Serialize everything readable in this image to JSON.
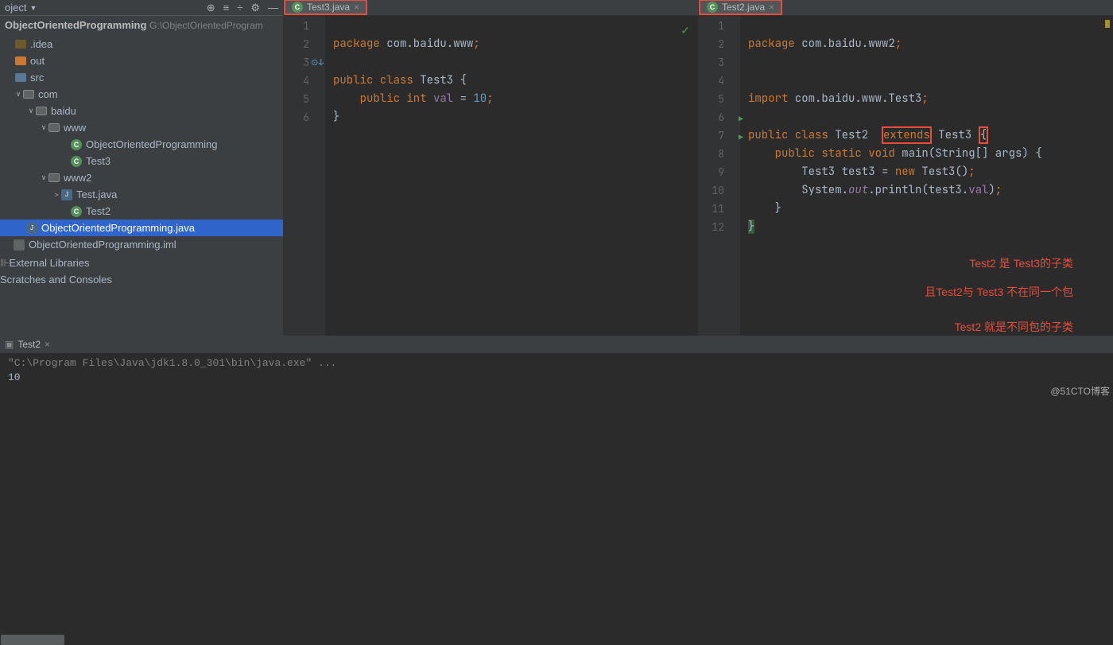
{
  "sidebar": {
    "dropdown": "oject",
    "proj_name": "ObjectOrientedProgramming",
    "proj_path": "G:\\ObjectOrientedProgram",
    "items": [
      {
        "indent": 8,
        "chev": "",
        "icon": "folder-idea",
        "label": ".idea"
      },
      {
        "indent": 8,
        "chev": "",
        "icon": "folder-out",
        "label": "out"
      },
      {
        "indent": 8,
        "chev": "",
        "icon": "folder-src",
        "label": "src"
      },
      {
        "indent": 18,
        "chev": "∨",
        "icon": "folder-pkg",
        "label": "com"
      },
      {
        "indent": 34,
        "chev": "∨",
        "icon": "folder-pkg",
        "label": "baidu"
      },
      {
        "indent": 50,
        "chev": "∨",
        "icon": "folder-pkg",
        "label": "www"
      },
      {
        "indent": 78,
        "chev": "",
        "icon": "class",
        "label": "ObjectOrientedProgramming"
      },
      {
        "indent": 78,
        "chev": "",
        "icon": "class",
        "label": "Test3"
      },
      {
        "indent": 50,
        "chev": "∨",
        "icon": "folder-pkg",
        "label": "www2"
      },
      {
        "indent": 66,
        "chev": ">",
        "icon": "java",
        "label": "Test.java"
      },
      {
        "indent": 78,
        "chev": "",
        "icon": "class",
        "label": "Test2"
      },
      {
        "indent": 22,
        "chev": "",
        "icon": "java",
        "label": "ObjectOrientedProgramming.java",
        "selected": true
      },
      {
        "indent": 6,
        "chev": "",
        "icon": "plain",
        "label": "ObjectOrientedProgramming.iml"
      }
    ],
    "external_libs": "External Libraries",
    "scratches": "Scratches and Consoles"
  },
  "editor_left": {
    "tab": "Test3.java",
    "lines": [
      "1",
      "2",
      "3",
      "4",
      "5",
      "6"
    ],
    "code": {
      "l1a": "package",
      "l1b": " com.baidu.www",
      "l1c": ";",
      "l3a": "public class ",
      "l3b": "Test3 {",
      "l4a": "    public int ",
      "l4b": "val",
      "l4c": " = ",
      "l4d": "10",
      "l4e": ";",
      "l5": "}"
    }
  },
  "editor_right": {
    "tab": "Test2.java",
    "lines": [
      "1",
      "2",
      "3",
      "4",
      "5",
      "6",
      "7",
      "8",
      "9",
      "10",
      "11",
      "12"
    ],
    "code": {
      "l1a": "package",
      "l1b": " com.baidu.www2",
      "l1c": ";",
      "l4a": "import",
      "l4b": " com.baidu.www.Test3",
      "l4c": ";",
      "l6a": "public class ",
      "l6b": "Test2  ",
      "l6c": "extends",
      "l6d": " Test3 ",
      "l6e": "{",
      "l7a": "    public static void ",
      "l7b": "main",
      "l7c": "(String[] args) {",
      "l8a": "        Test3 test3 = ",
      "l8b": "new ",
      "l8c": "Test3()",
      "l8d": ";",
      "l9a": "        System.",
      "l9b": "out",
      "l9c": ".println(test3.",
      "l9d": "val",
      "l9e": ")",
      "l9f": ";",
      "l10": "    }",
      "l11": "}"
    },
    "annot1": "Test2 是 Test3的子类",
    "annot2": "且Test2与 Test3 不在同一个包",
    "annot3": "Test2 就是不同包的子类"
  },
  "run": {
    "tab": "Test2",
    "line1": "\"C:\\Program Files\\Java\\jdk1.8.0_301\\bin\\java.exe\" ...",
    "line2": "10"
  },
  "credit": "@51CTO博客"
}
